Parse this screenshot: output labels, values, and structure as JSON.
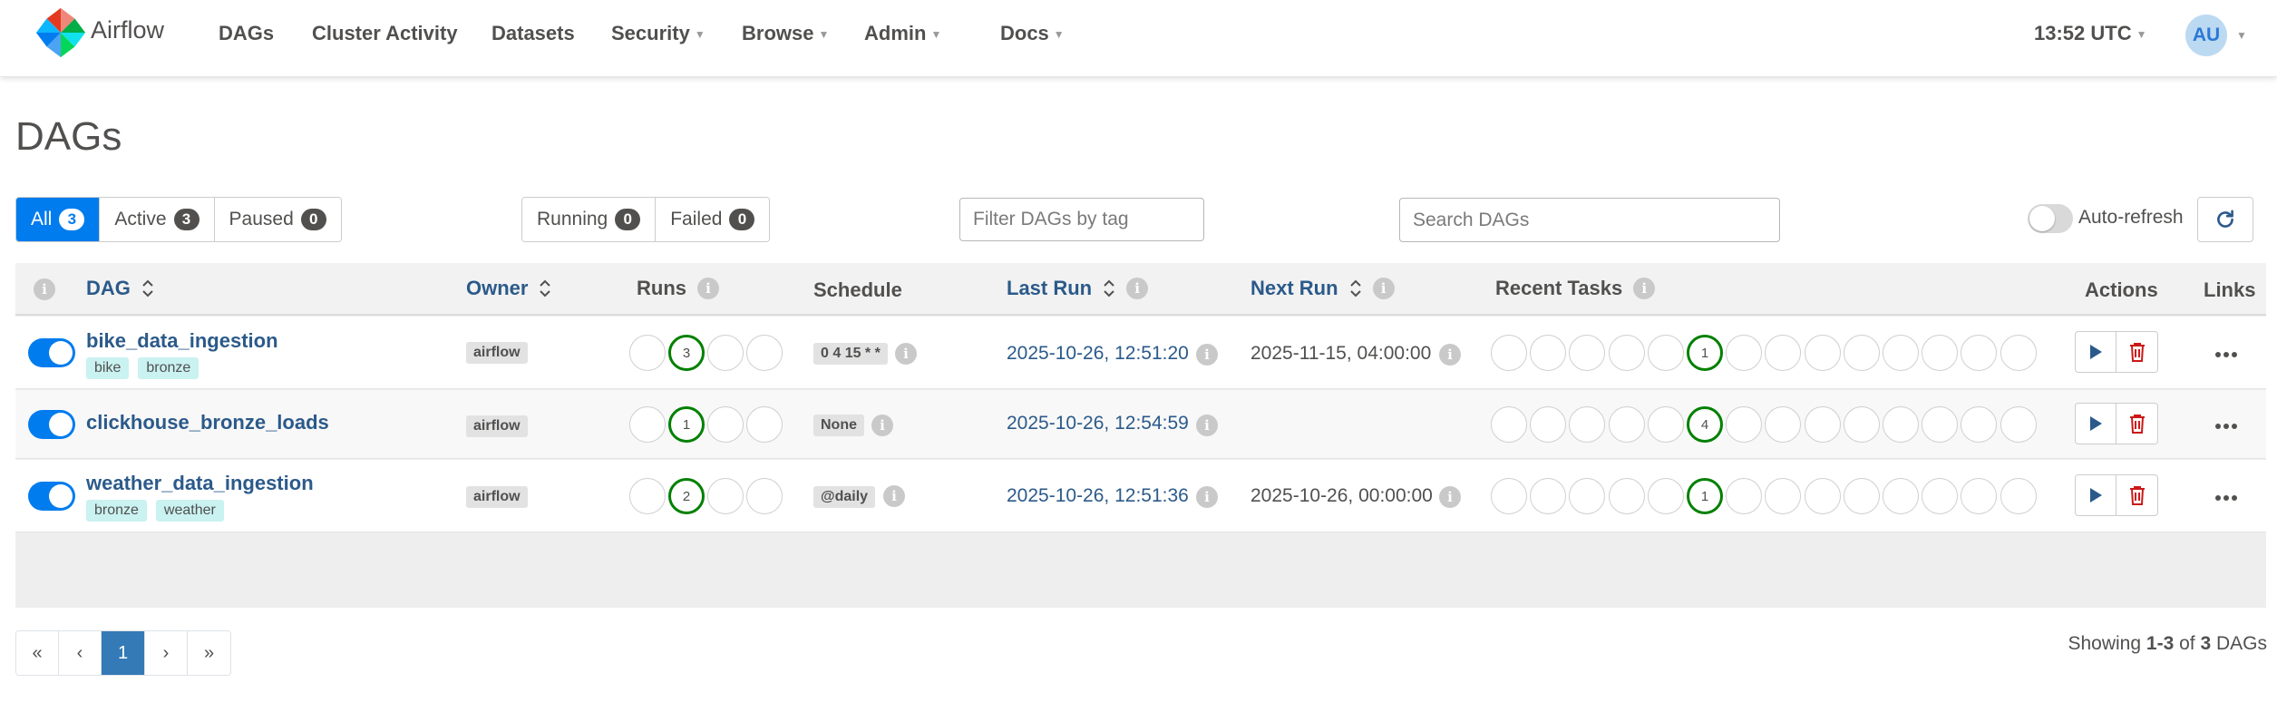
{
  "nav": {
    "brand": "Airflow",
    "items": [
      "DAGs",
      "Cluster Activity",
      "Datasets",
      "Security",
      "Browse",
      "Admin",
      "Docs"
    ],
    "clock": "13:52 UTC",
    "user_initials": "AU"
  },
  "page": {
    "title": "DAGs"
  },
  "filters": {
    "status": [
      {
        "label": "All",
        "count": "3",
        "active": true
      },
      {
        "label": "Active",
        "count": "3",
        "active": false
      },
      {
        "label": "Paused",
        "count": "0",
        "active": false
      }
    ],
    "state": [
      {
        "label": "Running",
        "count": "0"
      },
      {
        "label": "Failed",
        "count": "0"
      }
    ],
    "tag_placeholder": "Filter DAGs by tag",
    "search_placeholder": "Search DAGs",
    "auto_refresh_label": "Auto-refresh"
  },
  "table": {
    "headers": {
      "dag": "DAG",
      "owner": "Owner",
      "runs": "Runs",
      "schedule": "Schedule",
      "last_run": "Last Run",
      "next_run": "Next Run",
      "recent_tasks": "Recent Tasks",
      "actions": "Actions",
      "links": "Links"
    },
    "rows": [
      {
        "dag_id": "bike_data_ingestion",
        "tags": [
          "bike",
          "bronze"
        ],
        "owner": "airflow",
        "runs_success_count": "3",
        "schedule": "0 4 15 * *",
        "last_run": "2025-10-26, 12:51:20",
        "next_run": "2025-11-15, 04:00:00",
        "tasks_success_count": "1"
      },
      {
        "dag_id": "clickhouse_bronze_loads",
        "tags": [],
        "owner": "airflow",
        "runs_success_count": "1",
        "schedule": "None",
        "last_run": "2025-10-26, 12:54:59",
        "next_run": "",
        "tasks_success_count": "4"
      },
      {
        "dag_id": "weather_data_ingestion",
        "tags": [
          "bronze",
          "weather"
        ],
        "owner": "airflow",
        "runs_success_count": "2",
        "schedule": "@daily",
        "last_run": "2025-10-26, 12:51:36",
        "next_run": "2025-10-26, 00:00:00",
        "tasks_success_count": "1"
      }
    ]
  },
  "pagination": {
    "first": "«",
    "prev": "‹",
    "current": "1",
    "next": "›",
    "last": "»",
    "showing_prefix": "Showing",
    "range": "1-3",
    "of": "of",
    "total": "3",
    "suffix": "DAGs"
  },
  "colors": {
    "primary": "#017cee",
    "link": "#2b5a8a",
    "success": "#008000",
    "tag_bg": "#c9f2f1",
    "delete": "#cc1717"
  },
  "icons": [
    "pinwheel-logo-icon",
    "refresh-icon",
    "sort-icon",
    "info-icon",
    "play-icon",
    "trash-icon",
    "more-icon"
  ]
}
